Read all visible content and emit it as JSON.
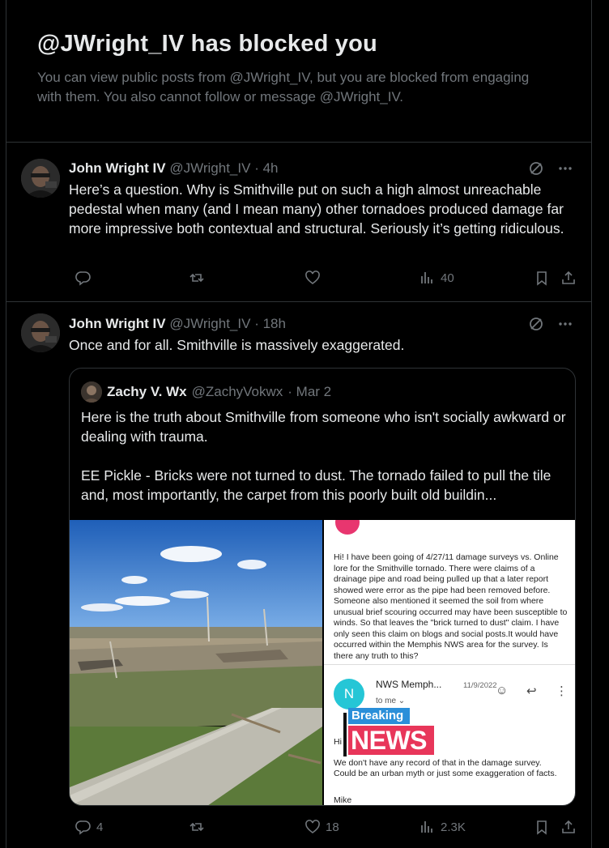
{
  "blocked": {
    "title": "@JWright_IV has blocked you",
    "message": "You can view public posts from @JWright_IV, but you are blocked from engaging with them. You also cannot follow or message @JWright_IV."
  },
  "tweets": [
    {
      "name": "John Wright IV",
      "handle": "@JWright_IV",
      "time": "· 4h",
      "text": "Here’s a question. Why is Smithville put on such a high almost unreachable pedestal when many (and I mean many) other tornadoes produced damage far more impressive both contextual and structural. Seriously it’s getting ridiculous.",
      "replies": "",
      "reposts": "",
      "likes": "",
      "views": "40"
    },
    {
      "name": "John Wright IV",
      "handle": "@JWright_IV",
      "time": "· 18h",
      "text": "Once and for all. Smithville is massively exaggerated.",
      "replies": "4",
      "reposts": "",
      "likes": "18",
      "views": "2.3K",
      "quote": {
        "name": "Zachy V. Wx",
        "handle": "@ZachyVokwx",
        "time": "· Mar 2",
        "text": "Here is the truth about Smithville from someone who isn't socially awkward or dealing with trauma.\n\nEE Pickle - Bricks were not turned to dust. The tornado failed to pull the tile and, most importantly, the carpet from this poorly built old buildin...",
        "screenshot": {
          "question": "Hi! I have been going of 4/27/11 damage surveys vs. Online lore for the Smithville tornado. There were claims of a drainage pipe and road being pulled up that a later report showed were error as the pipe had been removed before. Someone also mentioned it seemed the soil from where unusual brief scouring occurred may have been susceptible to winds. So that leaves the \"brick turned to dust\" claim. I have only seen this claim on blogs and social posts.It would have occurred within the Memphis NWS area for the survey. Is there any truth to this?",
          "avatar_letter": "N",
          "from": "NWS Memph...",
          "date": "11/9/2022",
          "to": "to me",
          "greeting": "Hi",
          "reply": "We don't have any record of that in the damage survey. Could be an urban myth or just some exaggeration of facts.",
          "signoff": "Mike",
          "overlay_top": "Breaking",
          "overlay_bottom": "NEWS"
        }
      }
    }
  ],
  "colors": {
    "background": "#000000",
    "text": "#e7e9ea",
    "muted": "#71767b",
    "border": "#2f3336",
    "breaking_blue": "#2a8fd9",
    "news_pink": "#e8365a"
  }
}
